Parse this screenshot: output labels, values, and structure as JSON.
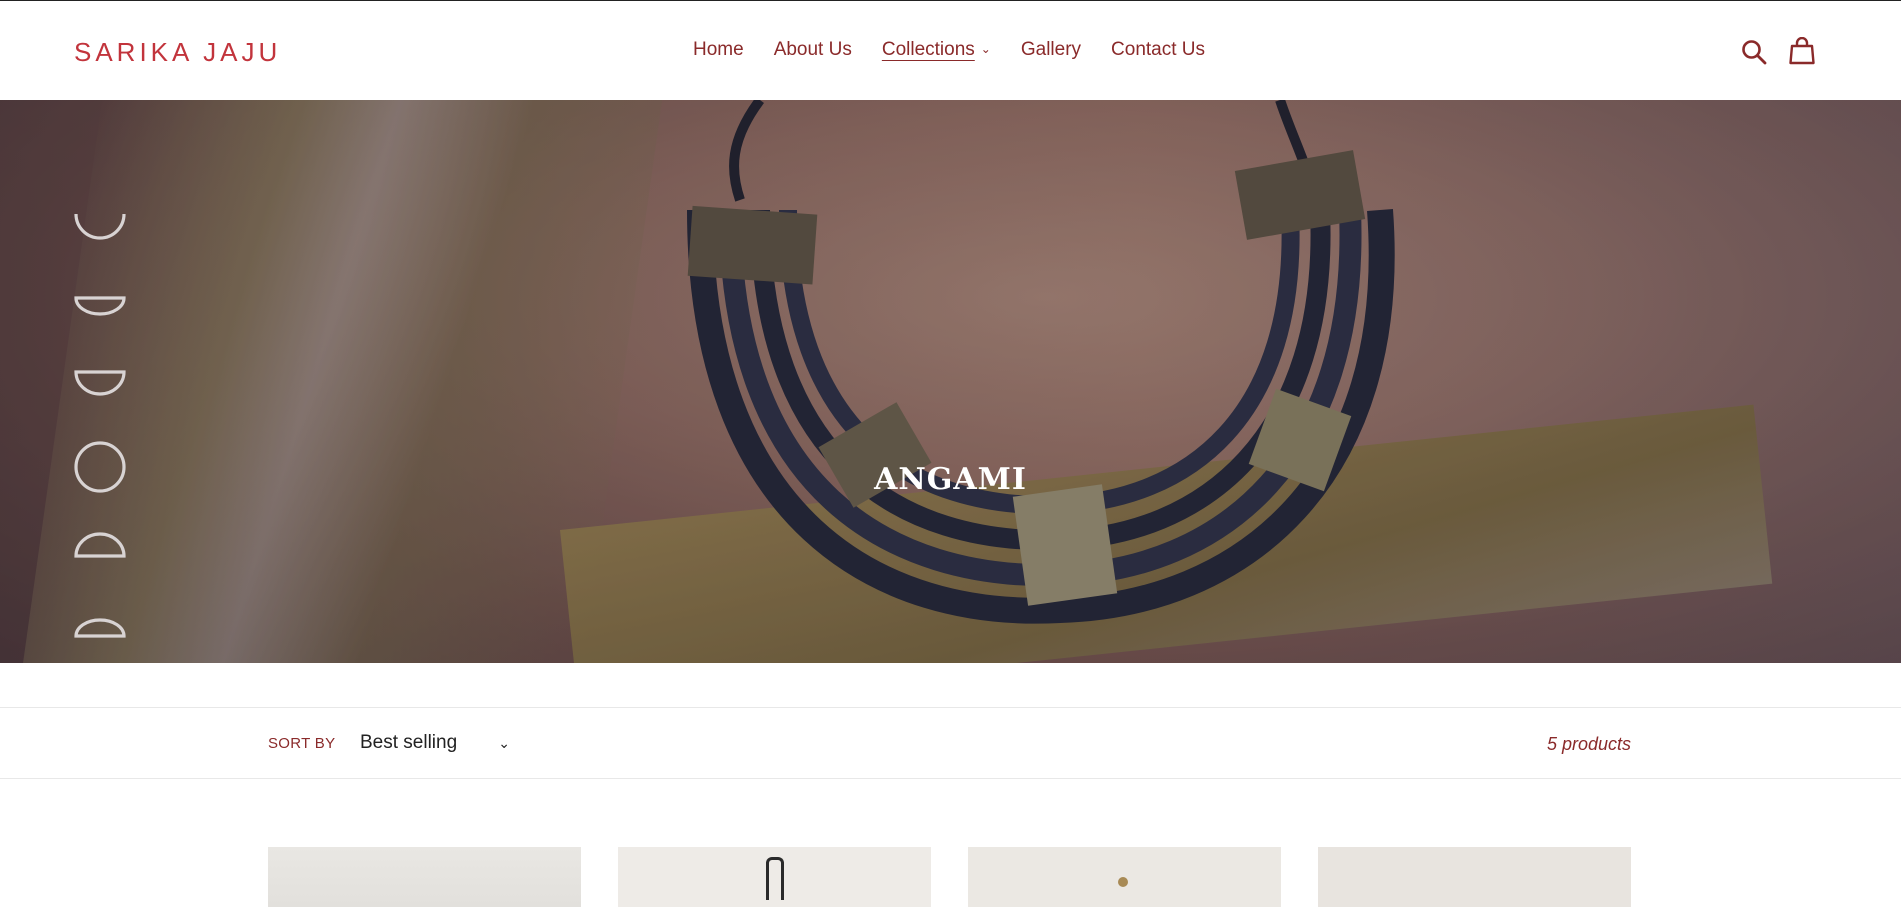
{
  "header": {
    "logo": "SARIKA JAJU",
    "nav": [
      {
        "label": "Home"
      },
      {
        "label": "About Us"
      },
      {
        "label": "Collections",
        "has_dropdown": true,
        "active": true
      },
      {
        "label": "Gallery"
      },
      {
        "label": "Contact Us"
      }
    ],
    "icons": [
      "search-icon",
      "cart-icon"
    ]
  },
  "hero": {
    "title": "ANGAMI"
  },
  "toolbar": {
    "sort_label": "SORT BY",
    "sort_value": "Best selling",
    "product_count": "5 products"
  },
  "colors": {
    "brand": "#c2343c",
    "text": "#8a2a2a"
  }
}
